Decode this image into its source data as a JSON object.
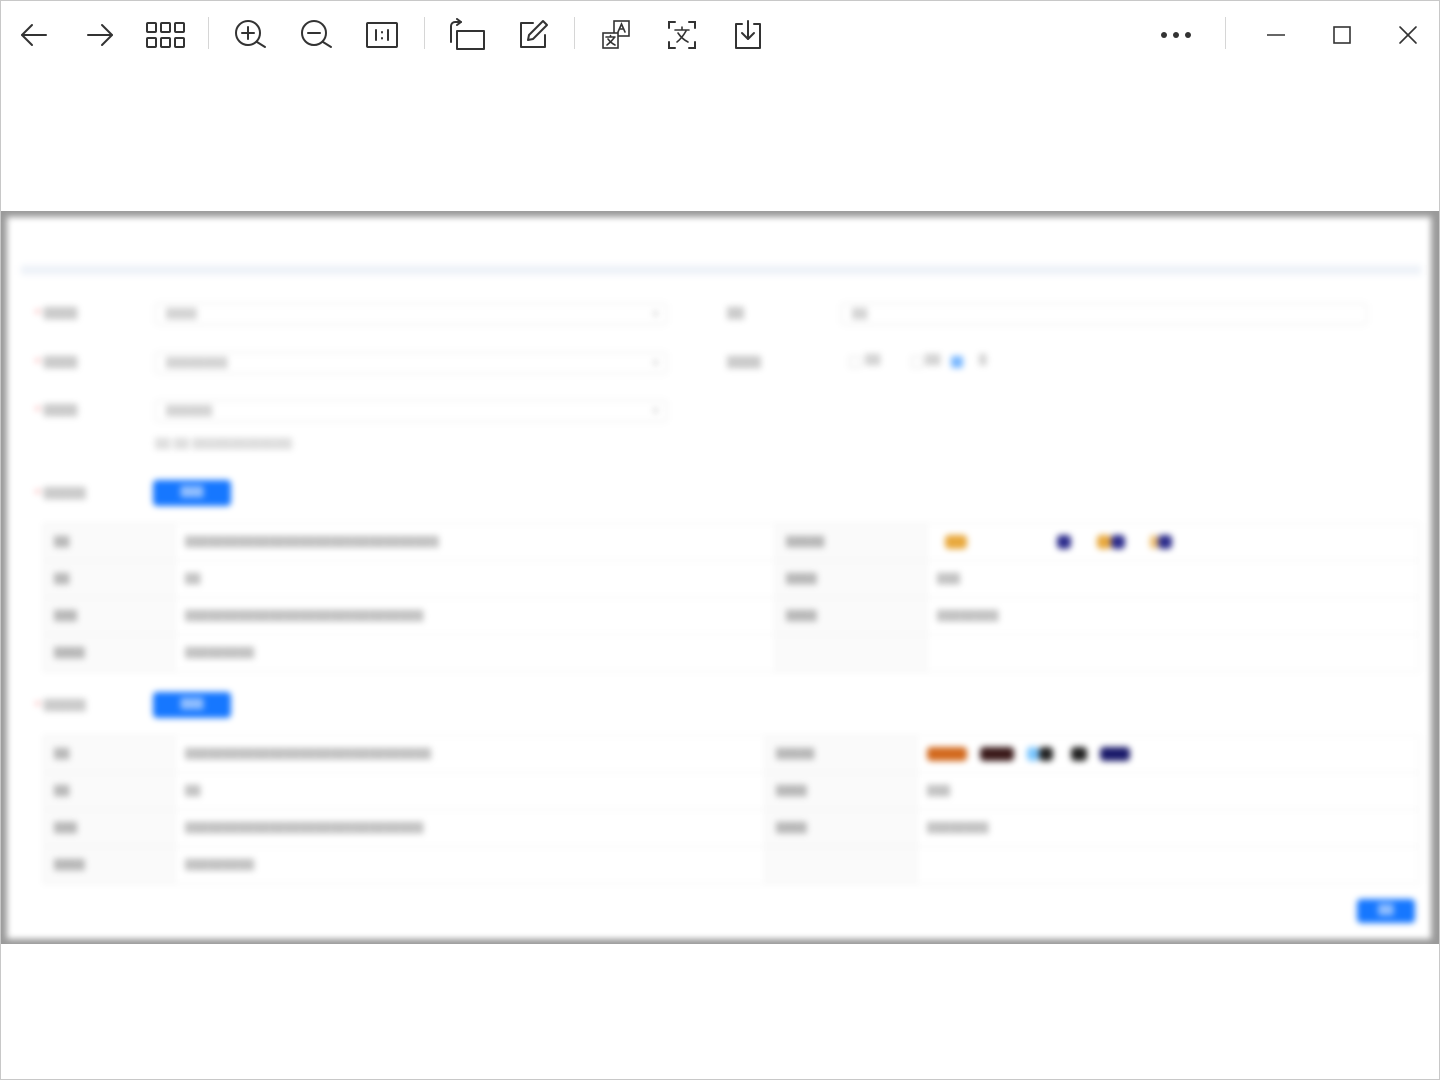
{
  "toolbar": {
    "left": [
      {
        "id": "back",
        "icon": "arrow-left-icon"
      },
      {
        "id": "forward",
        "icon": "arrow-right-icon"
      },
      {
        "id": "thumbnails",
        "icon": "grid-icon"
      },
      {
        "id": "zoom-in",
        "icon": "zoom-in-icon"
      },
      {
        "id": "zoom-out",
        "icon": "zoom-out-icon"
      },
      {
        "id": "actual-size",
        "icon": "actual-size-icon"
      },
      {
        "id": "rotate",
        "icon": "rotate-icon"
      },
      {
        "id": "edit",
        "icon": "edit-icon"
      },
      {
        "id": "translate",
        "icon": "translate-icon"
      },
      {
        "id": "ocr",
        "icon": "ocr-text-icon"
      },
      {
        "id": "save",
        "icon": "download-icon"
      }
    ],
    "right": [
      {
        "id": "more",
        "icon": "more-icon"
      },
      {
        "id": "minimize",
        "icon": "minimize-icon"
      },
      {
        "id": "maximize",
        "icon": "maximize-icon"
      },
      {
        "id": "close",
        "icon": "close-icon"
      }
    ]
  },
  "colors": {
    "icon": "#333333",
    "primary": "#1677ff",
    "viewer_bg": "#9a9a9a"
  },
  "image": {
    "title": "",
    "form_labels": [
      "",
      "",
      "",
      "",
      "",
      "",
      ""
    ],
    "select_values": [
      "",
      "",
      "",
      ""
    ],
    "hint": "",
    "table_rows": 4,
    "confirm_label": ""
  }
}
